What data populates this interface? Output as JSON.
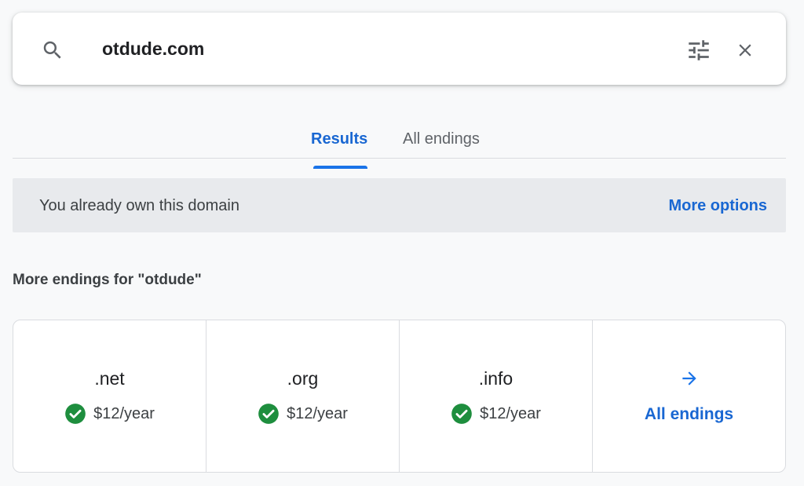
{
  "search": {
    "query": "otdude.com",
    "icons": {
      "search": "search-icon",
      "filter": "tune-icon",
      "clear": "close-icon"
    }
  },
  "tabs": [
    {
      "label": "Results",
      "active": true
    },
    {
      "label": "All endings",
      "active": false
    }
  ],
  "ownership_banner": {
    "message": "You already own this domain",
    "action_label": "More options"
  },
  "more_endings": {
    "heading": "More endings for \"otdude\"",
    "items": [
      {
        "ending": ".net",
        "price": "$12/year",
        "available": true
      },
      {
        "ending": ".org",
        "price": "$12/year",
        "available": true
      },
      {
        "ending": ".info",
        "price": "$12/year",
        "available": true
      }
    ],
    "see_all_label": "All endings"
  },
  "colors": {
    "accent": "#1a73e8",
    "link": "#1967d2",
    "available_green": "#1e8e3e",
    "banner_bg": "#e8eaed",
    "page_bg": "#f8f9fa"
  }
}
